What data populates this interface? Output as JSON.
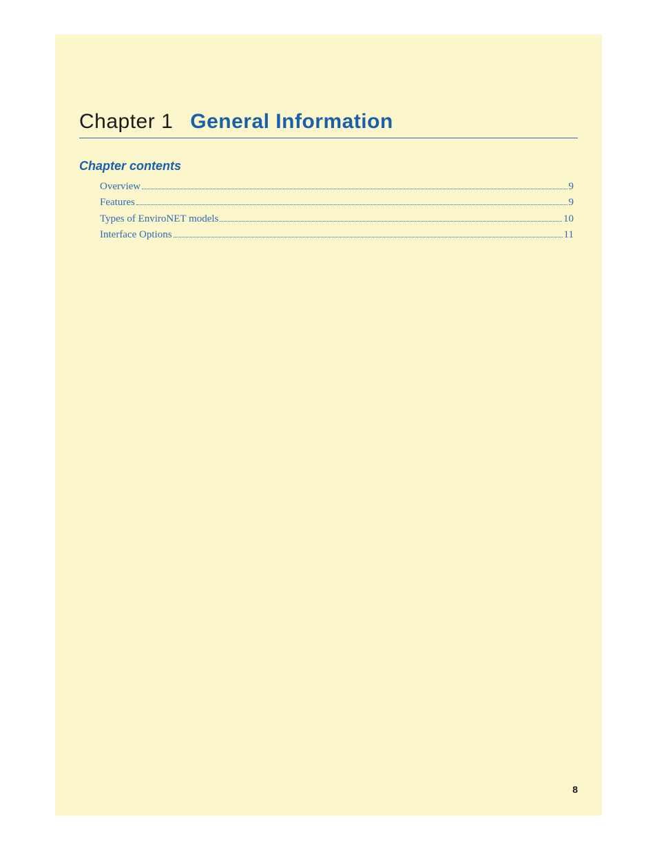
{
  "chapter": {
    "label": "Chapter 1",
    "title": "General Information"
  },
  "contents_heading": "Chapter contents",
  "toc": [
    {
      "title": "Overview",
      "page": "9"
    },
    {
      "title": "Features",
      "page": "9"
    },
    {
      "title": "Types of EnviroNET models",
      "page": "10"
    },
    {
      "title": "Interface Options",
      "page": "11"
    }
  ],
  "page_number": "8"
}
